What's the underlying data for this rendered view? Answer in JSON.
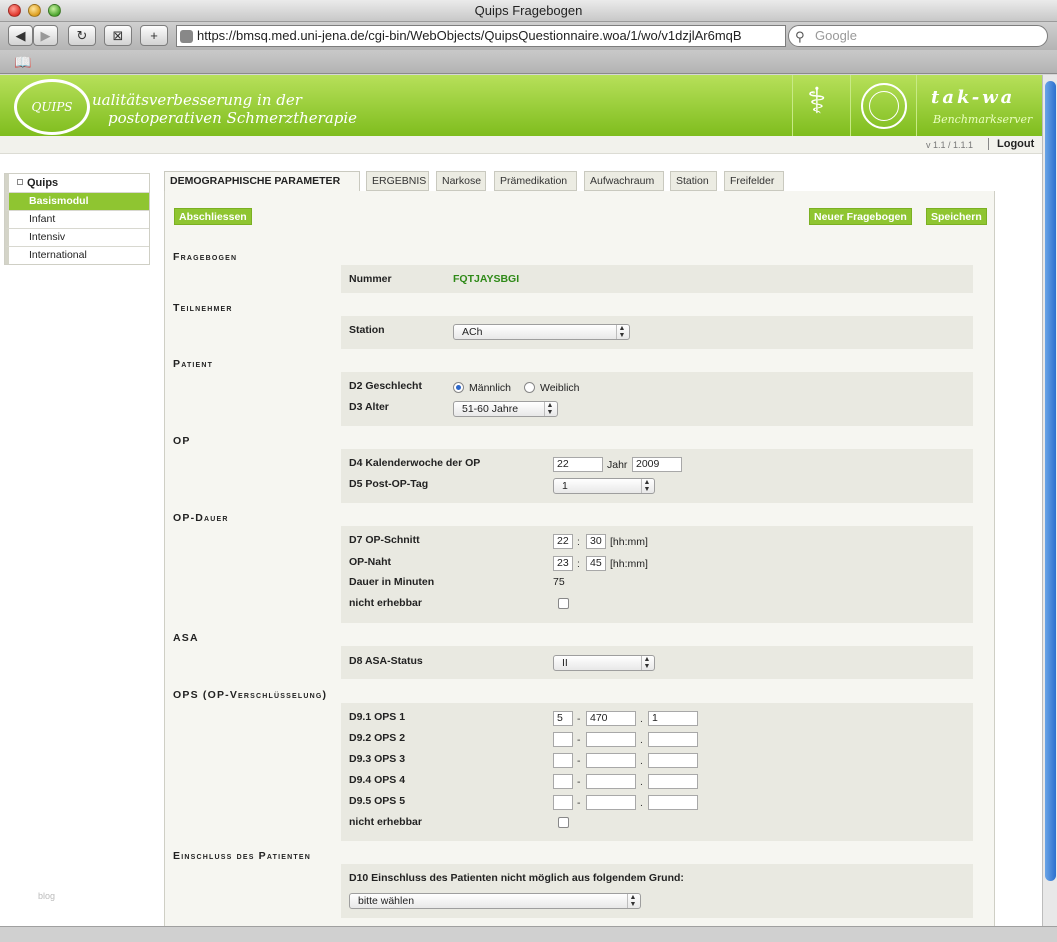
{
  "window": {
    "title": "Quips Fragebogen"
  },
  "browser": {
    "url": "https://bmsq.med.uni-jena.de/cgi-bin/WebObjects/QuipsQuestionnaire.woa/1/wo/v1dzjlAr6mqB",
    "search_placeholder": "Google",
    "back": "◀",
    "forward": "▶",
    "reload": "↻",
    "add": "+"
  },
  "header": {
    "logo": "QUIPS",
    "line1": "ualitätsverbesserung in der",
    "line2": "postoperativen Schmerztherapie",
    "emblem3_title": "tak-wa",
    "emblem3_sub": "Benchmarkserver",
    "version": "v 1.1 / 1.1.1",
    "logout": "Logout"
  },
  "sidebar": {
    "title": "Quips",
    "items": [
      {
        "label": "Basismodul",
        "active": true
      },
      {
        "label": "Infant",
        "active": false
      },
      {
        "label": "Intensiv",
        "active": false
      },
      {
        "label": "International",
        "active": false
      }
    ],
    "footer": "blog"
  },
  "tabs": [
    {
      "label": "DEMOGRAPHISCHE PARAMETER",
      "active": true
    },
    {
      "label": "ERGEBNIS",
      "active": false
    },
    {
      "label": "Narkose",
      "active": false
    },
    {
      "label": "Prämedikation",
      "active": false
    },
    {
      "label": "Aufwachraum",
      "active": false
    },
    {
      "label": "Station",
      "active": false
    },
    {
      "label": "Freifelder",
      "active": false
    }
  ],
  "actions": {
    "finish": "Abschliessen",
    "new": "Neuer Fragebogen",
    "save": "Speichern"
  },
  "sections": {
    "fragebogen": {
      "title": "Fragebogen",
      "nummer_label": "Nummer",
      "nummer_value": "FQTJAYSBGI"
    },
    "teilnehmer": {
      "title": "Teilnehmer",
      "station_label": "Station",
      "station_value": "ACh"
    },
    "patient": {
      "title": "Patient",
      "gender_label": "D2 Geschlecht",
      "male": "Männlich",
      "female": "Weiblich",
      "gender_selected": "Männlich",
      "age_label": "D3 Alter",
      "age_value": "51-60 Jahre"
    },
    "op": {
      "title": "OP",
      "kw_label": "D4 Kalenderwoche der OP",
      "kw_value": "22",
      "year_label": "Jahr",
      "year_value": "2009",
      "postop_label": "D5 Post-OP-Tag",
      "postop_value": "1"
    },
    "opdauer": {
      "title": "OP-Dauer",
      "schnitt_label": "D7 OP-Schnitt",
      "schnitt_h": "22",
      "schnitt_m": "30",
      "naht_label": "OP-Naht",
      "naht_h": "23",
      "naht_m": "45",
      "format": "[hh:mm]",
      "dauer_label": "Dauer in Minuten",
      "dauer_value": "75",
      "nicht_label": "nicht erhebbar",
      "colon": ":"
    },
    "asa": {
      "title": "ASA",
      "label": "D8 ASA-Status",
      "value": "II"
    },
    "ops": {
      "title": "OPS (OP-Verschlüsselung)",
      "rows": [
        {
          "label": "D9.1 OPS 1",
          "a": "5",
          "b": "470",
          "c": "1"
        },
        {
          "label": "D9.2 OPS 2",
          "a": "",
          "b": "",
          "c": ""
        },
        {
          "label": "D9.3 OPS 3",
          "a": "",
          "b": "",
          "c": ""
        },
        {
          "label": "D9.4 OPS 4",
          "a": "",
          "b": "",
          "c": ""
        },
        {
          "label": "D9.5 OPS 5",
          "a": "",
          "b": "",
          "c": ""
        }
      ],
      "dash": "-",
      "dot": ".",
      "nicht_label": "nicht erhebbar"
    },
    "einschluss": {
      "title": "Einschluss des Patienten",
      "label": "D10 Einschluss des Patienten nicht möglich aus folgendem Grund:",
      "value": "bitte wählen"
    }
  },
  "colors": {
    "accent": "#8fc531",
    "banner": "#9ccf35",
    "number_green": "#2f8a18"
  }
}
